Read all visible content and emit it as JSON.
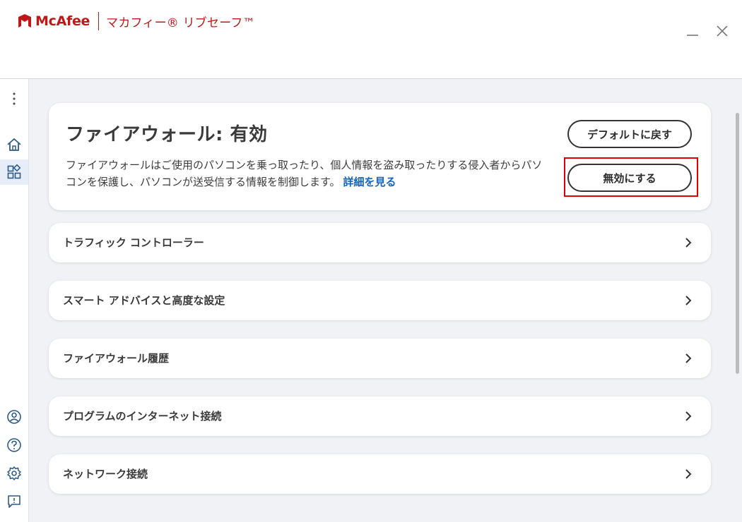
{
  "app": {
    "brand": "McAfee",
    "product": "マカフィー® リブセーフ™"
  },
  "colors": {
    "brand": "#c01818",
    "link": "#1565c0",
    "highlight": "#e00000",
    "active_nav_bg": "#e6edf8"
  },
  "window": {
    "minimize_icon": "minimize-icon",
    "close_icon": "close-icon"
  },
  "sidebar": {
    "items": [
      {
        "icon": "more-vertical-icon"
      },
      {
        "icon": "home-icon"
      },
      {
        "icon": "dashboard-icon",
        "active": true
      },
      {
        "icon": "account-icon"
      },
      {
        "icon": "help-icon"
      },
      {
        "icon": "settings-icon"
      },
      {
        "icon": "feedback-icon"
      }
    ]
  },
  "status": {
    "title": "ファイアウォール: 有効",
    "description": "ファイアウォールはご使用のパソコンを乗っ取ったり、個人情報を盗み取ったりする侵入者からパソコンを保護し、パソコンが送受信する情報を制御します。",
    "link": "詳細を見る",
    "default_button": "デフォルトに戻す",
    "disable_button": "無効にする"
  },
  "rows": [
    {
      "label": "トラフィック コントローラー"
    },
    {
      "label": "スマート アドバイスと高度な設定"
    },
    {
      "label": "ファイアウォール履歴"
    },
    {
      "label": "プログラムのインターネット接続"
    },
    {
      "label": "ネットワーク接続"
    }
  ]
}
